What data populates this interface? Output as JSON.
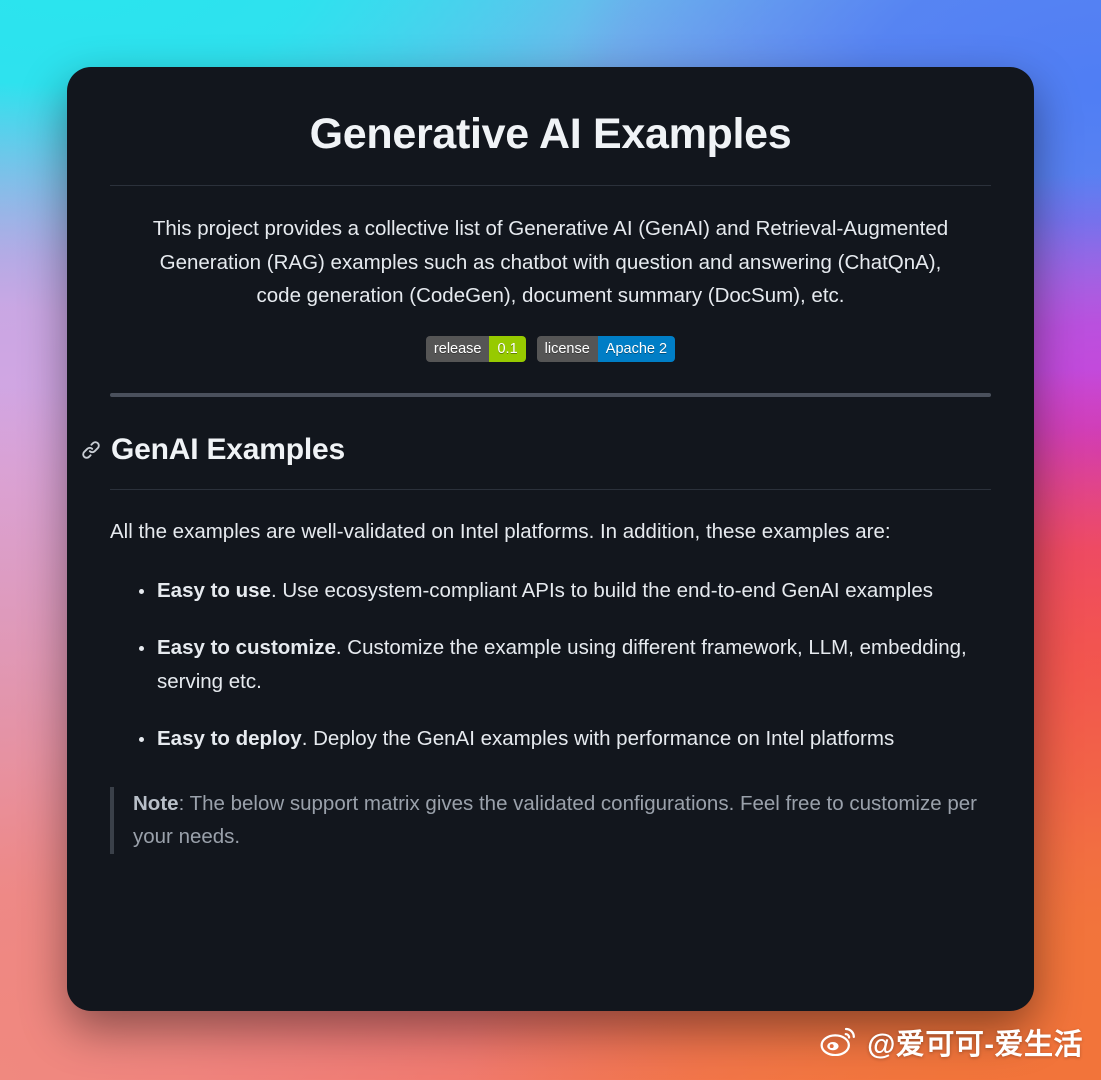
{
  "page": {
    "title": "Generative AI Examples",
    "intro": "This project provides a collective list of Generative AI (GenAI) and Retrieval-Augmented Generation (RAG) examples such as chatbot with question and answering (ChatQnA), code generation (CodeGen), document summary (DocSum), etc."
  },
  "badges": [
    {
      "name": "release-badge",
      "label": "release",
      "value": "0.1",
      "label_color": "#555555",
      "value_color": "#97ca00"
    },
    {
      "name": "license-badge",
      "label": "license",
      "value": "Apache 2",
      "label_color": "#555555",
      "value_color": "#007ec6"
    }
  ],
  "section": {
    "anchor_icon": "link-icon",
    "heading": "GenAI Examples",
    "intro": "All the examples are well-validated on Intel platforms. In addition, these examples are:",
    "bullets": [
      {
        "lead": "Easy to use",
        "rest": ". Use ecosystem-compliant APIs to build the end-to-end GenAI examples"
      },
      {
        "lead": "Easy to customize",
        "rest": ". Customize the example using different framework, LLM, embedding, serving etc."
      },
      {
        "lead": "Easy to deploy",
        "rest": ". Deploy the GenAI examples with performance on Intel platforms"
      }
    ],
    "note": {
      "lead": "Note",
      "rest": ": The below support matrix gives the validated configurations. Feel free to customize per your needs."
    }
  },
  "watermark": {
    "icon": "weibo-logo-icon",
    "text": "@爱可可-爱生活"
  },
  "colors": {
    "card_background": "#12161d",
    "text_primary": "#e6eaef",
    "text_muted": "#9aa1ab",
    "divider": "#4a505c",
    "rule": "#2b313b"
  }
}
